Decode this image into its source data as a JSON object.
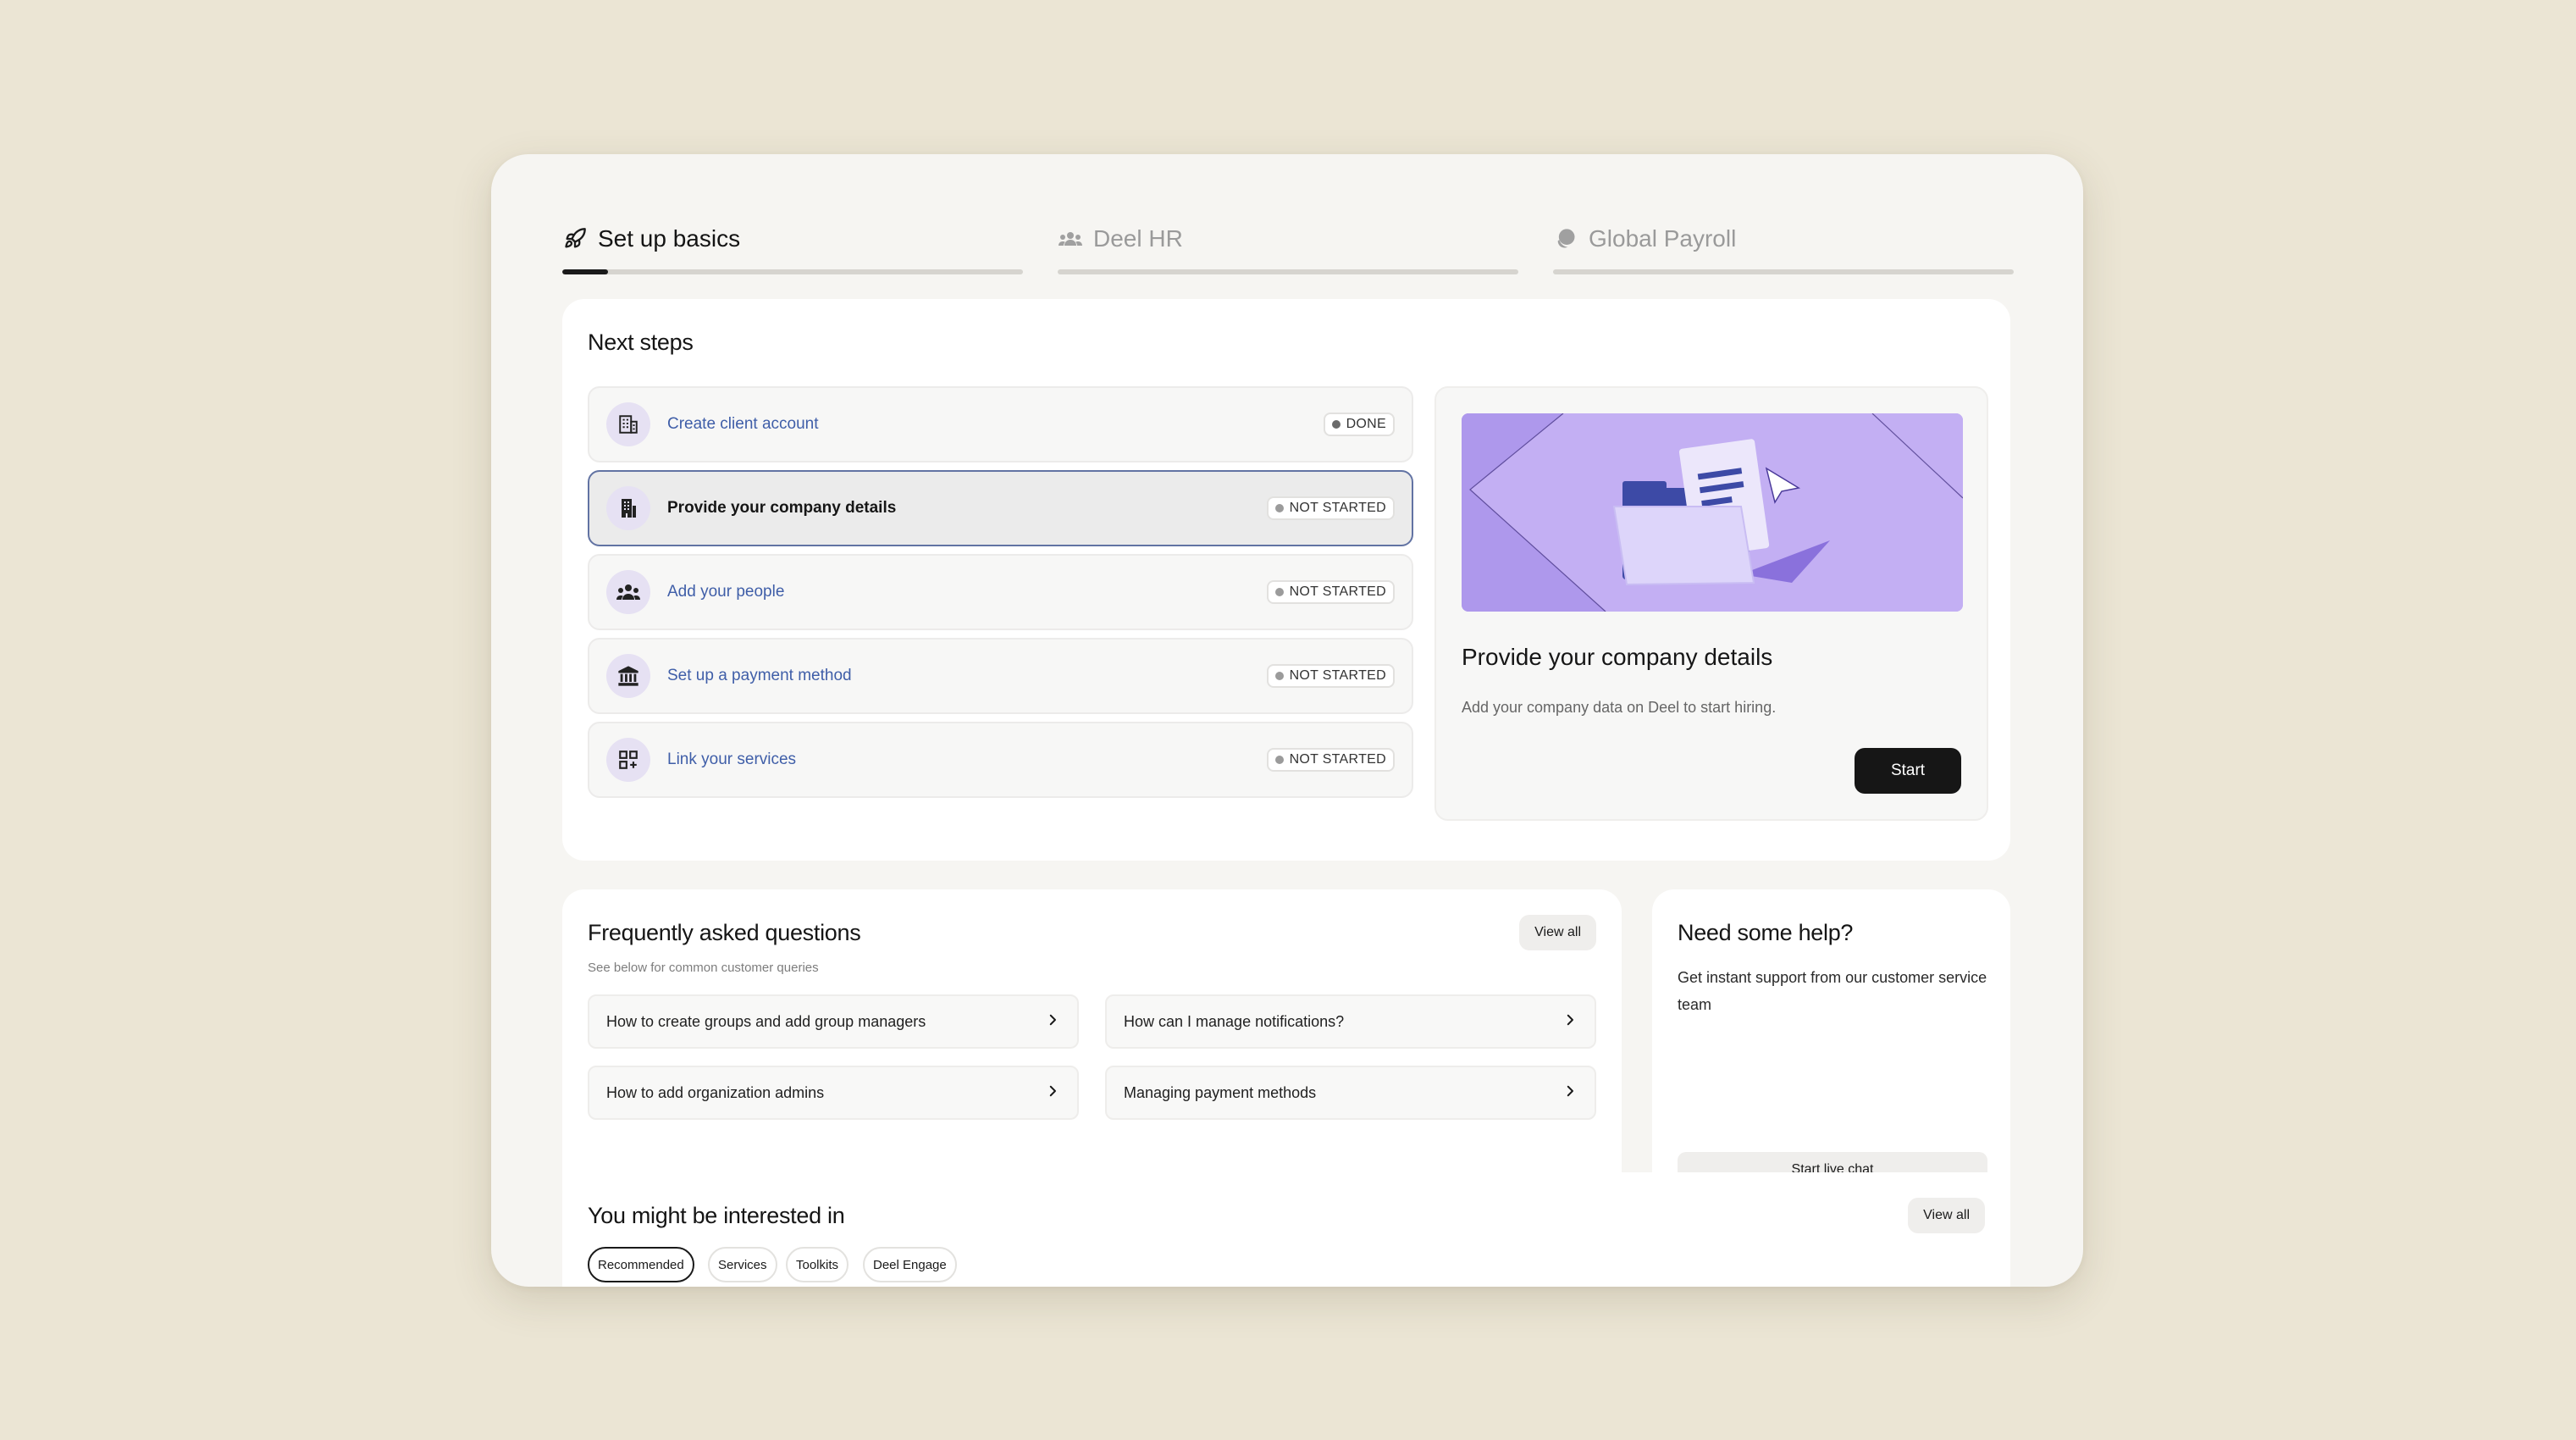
{
  "tabs": [
    {
      "label": "Set up basics",
      "icon": "rocket-icon",
      "active": true,
      "progress": 0.1
    },
    {
      "label": "Deel HR",
      "icon": "people-icon",
      "active": false,
      "progress": 0
    },
    {
      "label": "Global Payroll",
      "icon": "coin-icon",
      "active": false,
      "progress": 0
    }
  ],
  "next_steps": {
    "title": "Next steps",
    "items": [
      {
        "label": "Create client account",
        "icon": "building-icon",
        "status": "DONE"
      },
      {
        "label": "Provide your company details",
        "icon": "office-building-icon",
        "status": "NOT STARTED"
      },
      {
        "label": "Add your people",
        "icon": "people-icon",
        "status": "NOT STARTED"
      },
      {
        "label": "Set up a payment method",
        "icon": "bank-icon",
        "status": "NOT STARTED"
      },
      {
        "label": "Link your services",
        "icon": "apps-add-icon",
        "status": "NOT STARTED"
      }
    ],
    "detail": {
      "title": "Provide your company details",
      "description": "Add your company data on Deel to start hiring.",
      "button": "Start"
    }
  },
  "faq": {
    "title": "Frequently asked questions",
    "subtitle": "See below for common customer queries",
    "view_all": "View all",
    "items": [
      "How to create groups and add group managers",
      "How can I manage notifications?",
      "How to add organization admins",
      "Managing payment methods"
    ]
  },
  "help": {
    "title": "Need some help?",
    "text": "Get instant support from our customer service team",
    "button": "Start live chat"
  },
  "interested": {
    "title": "You might be interested in",
    "view_all": "View all",
    "chips": [
      "Recommended",
      "Services",
      "Toolkits",
      "Deel Engage"
    ],
    "active_chip": "Recommended"
  },
  "colors": {
    "background": "#ebe5d4",
    "link": "#3f5ea8",
    "accent_purple": "#c3aff3",
    "primary_button": "#161616"
  }
}
